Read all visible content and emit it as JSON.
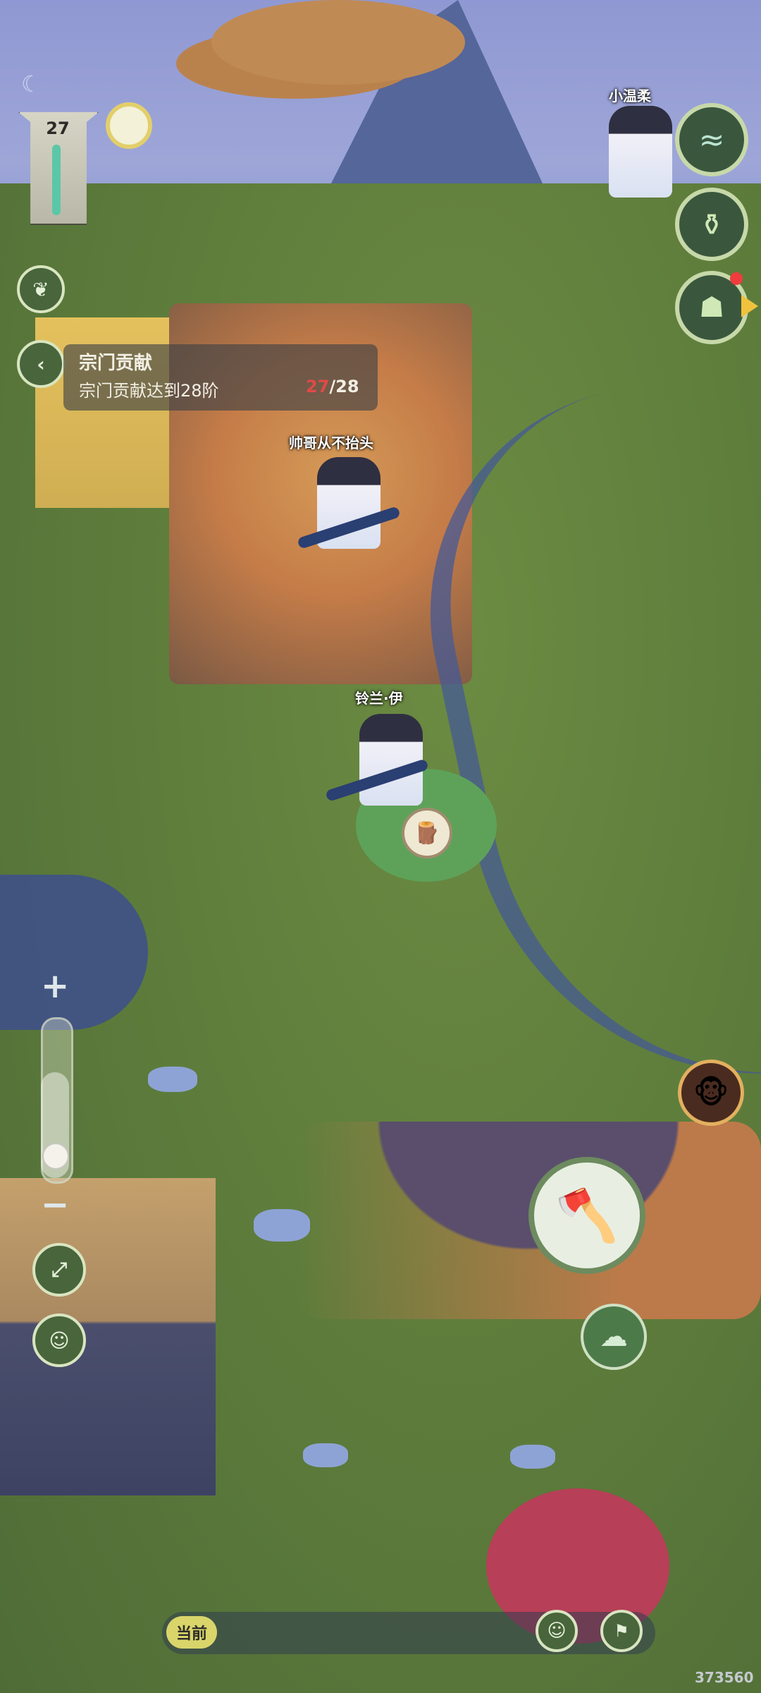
{
  "hud": {
    "level": "27",
    "moon_icon": "moon-icon",
    "ring_icon": "ring-icon",
    "back_icon": "back-icon",
    "leaf_icon": "leaf-icon"
  },
  "quest": {
    "title": "宗门贡献",
    "desc": "宗门贡献达到28阶",
    "current": "27",
    "target": "/28"
  },
  "characters": {
    "top_right": "小温柔",
    "tree_player": "帅哥从不抬头",
    "main_player": "铃兰·伊"
  },
  "right_buttons": {
    "wave": "wave-icon",
    "jar": "jar-icon",
    "monster": "monster-icon",
    "monkey": "monkey-icon"
  },
  "map_controls": {
    "zoom_plus": "+",
    "zoom_minus": "−",
    "expand_icon": "expand-icon",
    "character_icon": "character-icon",
    "zoom_level": 0.35
  },
  "actions": {
    "axe_icon": "axe-icon",
    "cloud_icon": "cloud-icon",
    "wood_icon": "wood-icon"
  },
  "chat": {
    "tag": "当前",
    "emoji_icon": "emoji-icon",
    "flag_icon": "flag-icon"
  },
  "watermark": "373560",
  "colors": {
    "accent": "#e04a47",
    "hud_text": "#f2efe4"
  }
}
